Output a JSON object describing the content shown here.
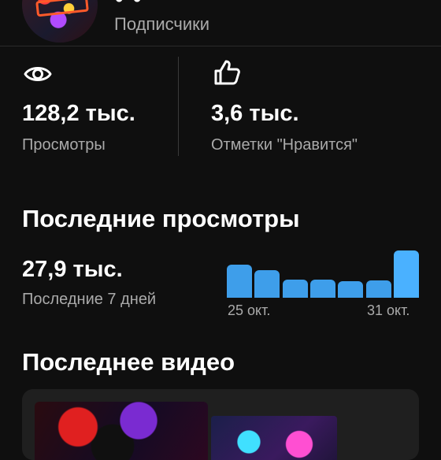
{
  "channel": {
    "subscribers_label": "Подписчики"
  },
  "stats": {
    "views": {
      "icon": "eye-icon",
      "value": "128,2 тыс.",
      "label": "Просмотры"
    },
    "likes": {
      "icon": "thumbs-up-icon",
      "value": "3,6 тыс.",
      "label": "Отметки \"Нравится\""
    }
  },
  "recent_views": {
    "title": "Последние просмотры",
    "value": "27,9 тыс.",
    "period": "Последние 7 дней",
    "start_date": "25 окт.",
    "end_date": "31 окт."
  },
  "chart_data": {
    "type": "bar",
    "title": "",
    "categories": [
      "25 окт.",
      "",
      "",
      "",
      "",
      "",
      "31 окт."
    ],
    "values": [
      41,
      34,
      22,
      22,
      20,
      21,
      58
    ],
    "colors": {
      "bar": "#3e9eea",
      "highlight": "#4ab1ff"
    }
  },
  "latest_video": {
    "title": "Последнее видео"
  },
  "colors": {
    "background": "#0f0f0f",
    "text_primary": "#ffffff",
    "text_secondary": "#aaaaaa",
    "accent": "#3e9eea"
  }
}
